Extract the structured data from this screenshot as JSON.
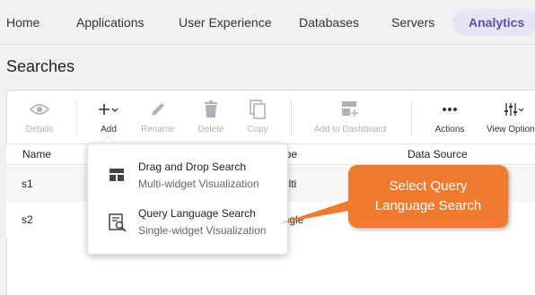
{
  "nav": {
    "items": [
      "Home",
      "Applications",
      "User Experience",
      "Databases",
      "Servers"
    ],
    "active": "Analytics"
  },
  "page_title": "Searches",
  "toolbar": {
    "details": "Details",
    "add": "Add",
    "rename": "Rename",
    "delete": "Delete",
    "copy": "Copy",
    "add_to_dashboard": "Add to Dashboard",
    "actions": "Actions",
    "view_options": "View Options"
  },
  "table": {
    "headers": {
      "name": "Name",
      "type": "Type",
      "data_source": "Data Source"
    },
    "rows": [
      {
        "name": "s1",
        "type": "Multi"
      },
      {
        "name": "s2",
        "type": "Single"
      }
    ]
  },
  "menu": {
    "items": [
      {
        "title": "Drag and Drop Search",
        "subtitle": "Multi-widget Visualization",
        "icon": "layout-icon"
      },
      {
        "title": "Query Language Search",
        "subtitle": "Single-widget Visualization",
        "icon": "query-search-icon"
      }
    ]
  },
  "callout": {
    "line1": "Select Query",
    "line2": "Language Search"
  },
  "colors": {
    "accent": "#5b4bb7",
    "callout": "#f07a2e",
    "active_tab_bg": "#e7e5f4"
  }
}
